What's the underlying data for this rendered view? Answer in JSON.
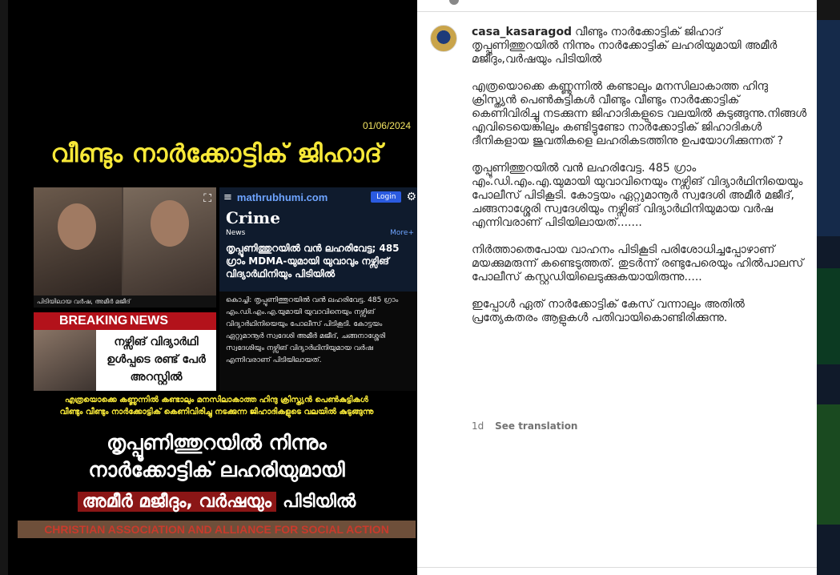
{
  "post": {
    "date": "01/06/2024",
    "headline": "വീണ്ടും നാർക്കോട്ടിക് ജിഹാദ്",
    "photo_caption": "പിടിയിലായ വർഷ, അമീർ മജീദ്",
    "breaking_label_1": "BREAKING",
    "breaking_label_2": "NEWS",
    "breaking_text": "നഴ്സിങ് വിദ്യാർഥി ഉൾപ്പടെ രണ്ട് പേർ അറസ്റ്റിൽ",
    "news_site": "mathrubhumi.com",
    "login": "Login",
    "section": "Crime",
    "news_label": "News",
    "more_label": "More+",
    "news_title": "തൃപ്പൂണിത്തുറയിൽ വൻ ലഹരിവേട്ട; 485 ഗ്രാം MDMA-യുമായി യുവാവും നഴ്സിങ് വിദ്യാർഥിനിയും പിടിയിൽ",
    "news_body": "കൊച്ചി: തൃപ്പൂണിത്തുറയിൽ വൻ ലഹരിവേട്ട. 485 ഗ്രാം എം.ഡി.എം.എ.യുമായി യുവാവിനെയും നഴ്സിങ് വിദ്യാർഥിനിയെയും പോലീസ് പിടികൂടി. കോട്ടയം ഏറ്റുമാനൂർ സ്വദേശി അമീർ മജീദ്, ചങ്ങനാശ്ശേരി സ്വദേശിയും നഴ്സിങ് വിദ്യാർഥിനിയുമായ വർഷ എന്നിവരാണ് പിടിയിലായത്.",
    "sub_text_1": "എത്രയൊക്കെ കണ്ണുന്നിൽ കണ്ടാലും മനസിലാകാത്ത ഹിന്ദു ക്രിസ്ത്യൻ പെൺകുട്ടികൾ",
    "sub_text_2": "വീണ്ടും വീണ്ടും നാർക്കോട്ടിക് കെണിവിരിച്ചു നടക്കുന്ന ജിഹാദികളുടെ വലയിൽ കുടുങ്ങുന്നു",
    "big_1": "തൃപ്പൂണിത്തുറയിൽ നിന്നും",
    "big_2": "നാർക്കോട്ടിക് ലഹരിയുമായി",
    "big_3a": "അമീർ മജീദും, വർഷയും",
    "big_3b": "പിടിയിൽ",
    "banner": "CHRISTIAN ASSOCIATION AND ALLIANCE FOR SOCIAL ACTION"
  },
  "comment": {
    "username": "casa_kasaragod",
    "paragraphs": [
      "വീണ്ടും നാർക്കോട്ടിക് ജിഹാദ് തൃപ്പൂണിത്തുറയിൽ നിന്നും നാർക്കോട്ടിക് ലഹരിയുമായി അമീർ മജീദും,വർഷയും പിടിയിൽ",
      "എത്രയൊക്കെ കണ്ണുന്നിൽ കണ്ടാലും മനസിലാകാത്ത ഹിന്ദു ക്രിസ്ത്യൻ പെൺകുട്ടികൾ വീണ്ടും വീണ്ടും നാർക്കോട്ടിക് കെണിവിരിച്ചു നടക്കുന്ന ജിഹാദികളുടെ വലയിൽ കുടുങ്ങുന്നു.നിങ്ങൾ എവിടെയെങ്കിലും കണ്ടിട്ടുണ്ടോ നാർക്കോട്ടിക് ജിഹാദികൾ ദീനികളായ ജുവതികളെ ലഹരികടത്തിനു ഉപയോഗിക്കുന്നത് ?",
      "തൃപ്പൂണിത്തുറയിൽ വൻ ലഹരിവേട്ട. 485 ഗ്രാം എം.ഡി.എം.എ.യുമായി യുവാവിനെയും നഴ്സിങ് വിദ്യാർഥിനിയെയും പോലീസ് പിടികൂടി. കോട്ടയം ഏറ്റുമാനൂർ സ്വദേശി അമീർ മജീദ്, ചങ്ങനാശ്ശേരി സ്വദേശിയും നഴ്സിങ് വിദ്യാർഥിനിയുമായ വർഷ എന്നിവരാണ് പിടിയിലായത്.......",
      "നിർത്താതെപോയ വാഹനം പിടികൂടി പരിശോധിച്ചപ്പോഴാണ് മയക്കുമരുന്ന് കണ്ടെടുത്തത്. തുടർന്ന് രണ്ടുപേരെയും ഹിൽപാലസ് പോലീസ് കസ്റ്റഡിയിലെടുക്കുകയായിരുന്നു.....",
      "ഇപ്പോൾ ഏത് നാർക്കോട്ടിക് കേസ് വന്നാലും അതിൽ പ്രത്യേകതരം ആളുകൾ പതിവായികൊണ്ടിരിക്കുന്നു."
    ],
    "time": "1d",
    "translate": "See translation"
  }
}
